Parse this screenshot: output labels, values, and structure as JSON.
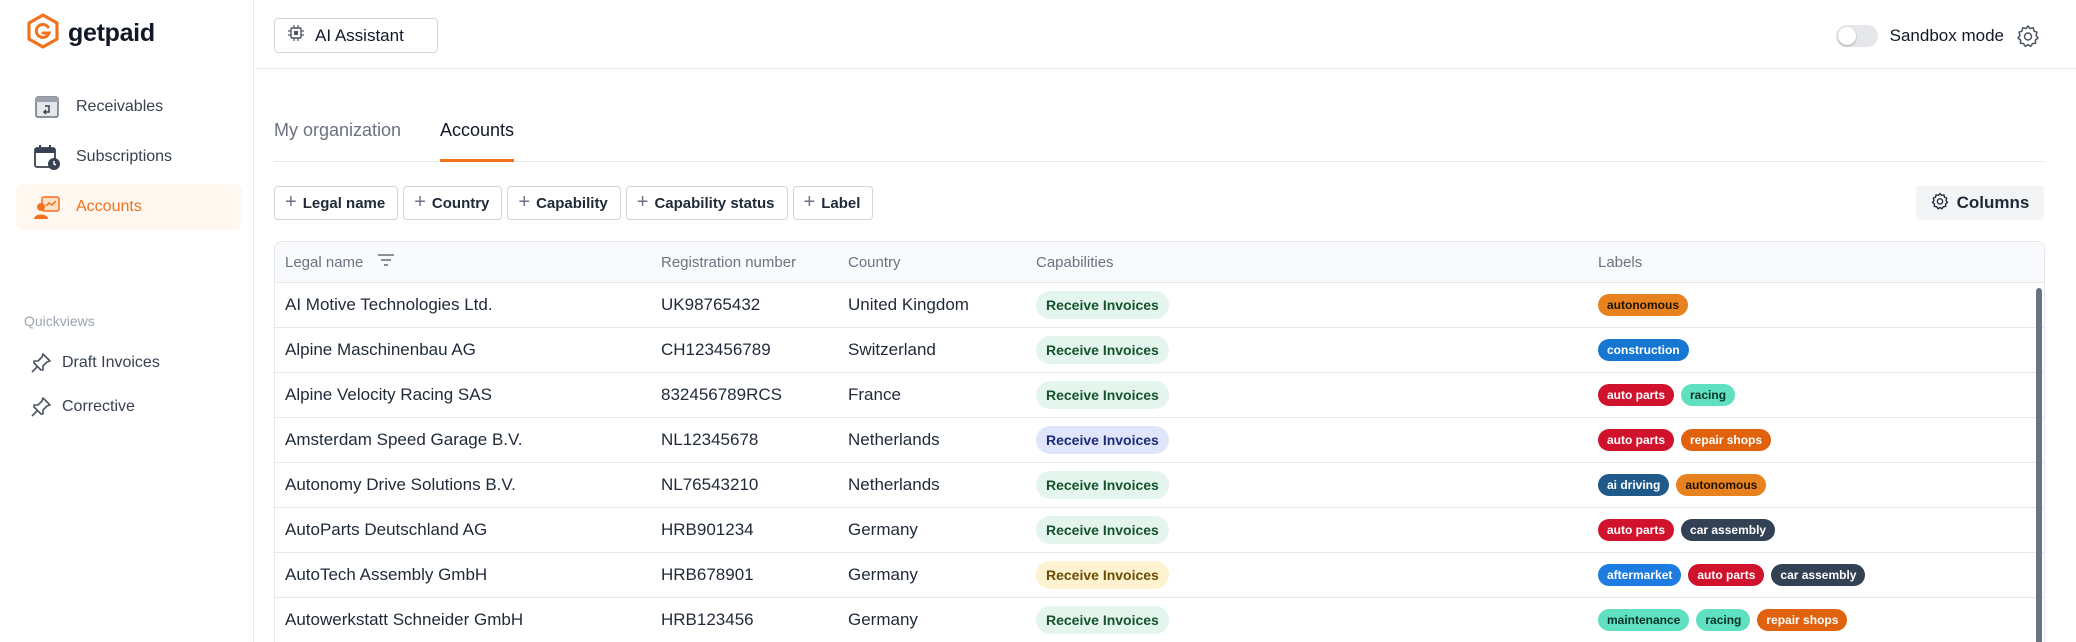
{
  "brand": {
    "name": "getpaid",
    "accent": "#f2711c"
  },
  "sidebar": {
    "items": [
      {
        "label": "Receivables",
        "icon": "receivables-icon",
        "active": false
      },
      {
        "label": "Subscriptions",
        "icon": "subscriptions-icon",
        "active": false
      },
      {
        "label": "Accounts",
        "icon": "accounts-icon",
        "active": true
      }
    ],
    "quickviews_title": "Quickviews",
    "quickviews": [
      {
        "label": "Draft Invoices",
        "icon": "pin-icon"
      },
      {
        "label": "Corrective",
        "icon": "pin-icon"
      }
    ]
  },
  "header": {
    "ai_assistant_label": "AI Assistant",
    "sandbox_label": "Sandbox mode",
    "sandbox_on": false
  },
  "tabs": [
    {
      "label": "My organization",
      "active": false
    },
    {
      "label": "Accounts",
      "active": true
    }
  ],
  "filters": [
    "Legal name",
    "Country",
    "Capability",
    "Capability status",
    "Label"
  ],
  "columns_label": "Columns",
  "table": {
    "headers": {
      "legal_name": "Legal name",
      "registration_number": "Registration number",
      "country": "Country",
      "capabilities": "Capabilities",
      "labels": "Labels"
    },
    "rows": [
      {
        "legal_name": "AI Motive Technologies Ltd.",
        "registration_number": "UK98765432",
        "country": "United Kingdom",
        "capability": "Receive Invoices",
        "capability_status": "green",
        "labels": [
          {
            "text": "autonomous",
            "bg": "#e8821e",
            "fg": "#1f1300"
          }
        ]
      },
      {
        "legal_name": "Alpine Maschinenbau AG",
        "registration_number": "CH123456789",
        "country": "Switzerland",
        "capability": "Receive Invoices",
        "capability_status": "green",
        "labels": [
          {
            "text": "construction",
            "bg": "#1677d2",
            "fg": "#ffffff"
          }
        ]
      },
      {
        "legal_name": "Alpine Velocity Racing SAS",
        "registration_number": "832456789RCS",
        "country": "France",
        "capability": "Receive Invoices",
        "capability_status": "green",
        "labels": [
          {
            "text": "auto parts",
            "bg": "#d0122d",
            "fg": "#ffffff"
          },
          {
            "text": "racing",
            "bg": "#5fe0c0",
            "fg": "#05332a"
          }
        ]
      },
      {
        "legal_name": "Amsterdam Speed Garage B.V.",
        "registration_number": "NL12345678",
        "country": "Netherlands",
        "capability": "Receive Invoices",
        "capability_status": "blue",
        "labels": [
          {
            "text": "auto parts",
            "bg": "#d0122d",
            "fg": "#ffffff"
          },
          {
            "text": "repair shops",
            "bg": "#e0620c",
            "fg": "#ffffff"
          }
        ]
      },
      {
        "legal_name": "Autonomy Drive Solutions B.V.",
        "registration_number": "NL76543210",
        "country": "Netherlands",
        "capability": "Receive Invoices",
        "capability_status": "green",
        "labels": [
          {
            "text": "ai driving",
            "bg": "#1f5a8a",
            "fg": "#ffffff"
          },
          {
            "text": "autonomous",
            "bg": "#e8821e",
            "fg": "#1f1300"
          }
        ]
      },
      {
        "legal_name": "AutoParts Deutschland AG",
        "registration_number": "HRB901234",
        "country": "Germany",
        "capability": "Receive Invoices",
        "capability_status": "green",
        "labels": [
          {
            "text": "auto parts",
            "bg": "#d0122d",
            "fg": "#ffffff"
          },
          {
            "text": "car assembly",
            "bg": "#334155",
            "fg": "#ffffff"
          }
        ]
      },
      {
        "legal_name": "AutoTech Assembly GmbH",
        "registration_number": "HRB678901",
        "country": "Germany",
        "capability": "Receive Invoices",
        "capability_status": "yellow",
        "labels": [
          {
            "text": "aftermarket",
            "bg": "#1e7be0",
            "fg": "#ffffff"
          },
          {
            "text": "auto parts",
            "bg": "#d0122d",
            "fg": "#ffffff"
          },
          {
            "text": "car assembly",
            "bg": "#334155",
            "fg": "#ffffff"
          }
        ]
      },
      {
        "legal_name": "Autowerkstatt Schneider GmbH",
        "registration_number": "HRB123456",
        "country": "Germany",
        "capability": "Receive Invoices",
        "capability_status": "green",
        "labels": [
          {
            "text": "maintenance",
            "bg": "#5fe0c0",
            "fg": "#05332a"
          },
          {
            "text": "racing",
            "bg": "#5fe0c0",
            "fg": "#05332a"
          },
          {
            "text": "repair shops",
            "bg": "#e0620c",
            "fg": "#ffffff"
          }
        ]
      }
    ]
  },
  "capability_colors": {
    "green": {
      "bg": "#e3f5ec",
      "fg": "#14532d"
    },
    "blue": {
      "bg": "#dfe6fb",
      "fg": "#1e2a78"
    },
    "yellow": {
      "bg": "#fdf3d0",
      "fg": "#6b4d00"
    }
  }
}
